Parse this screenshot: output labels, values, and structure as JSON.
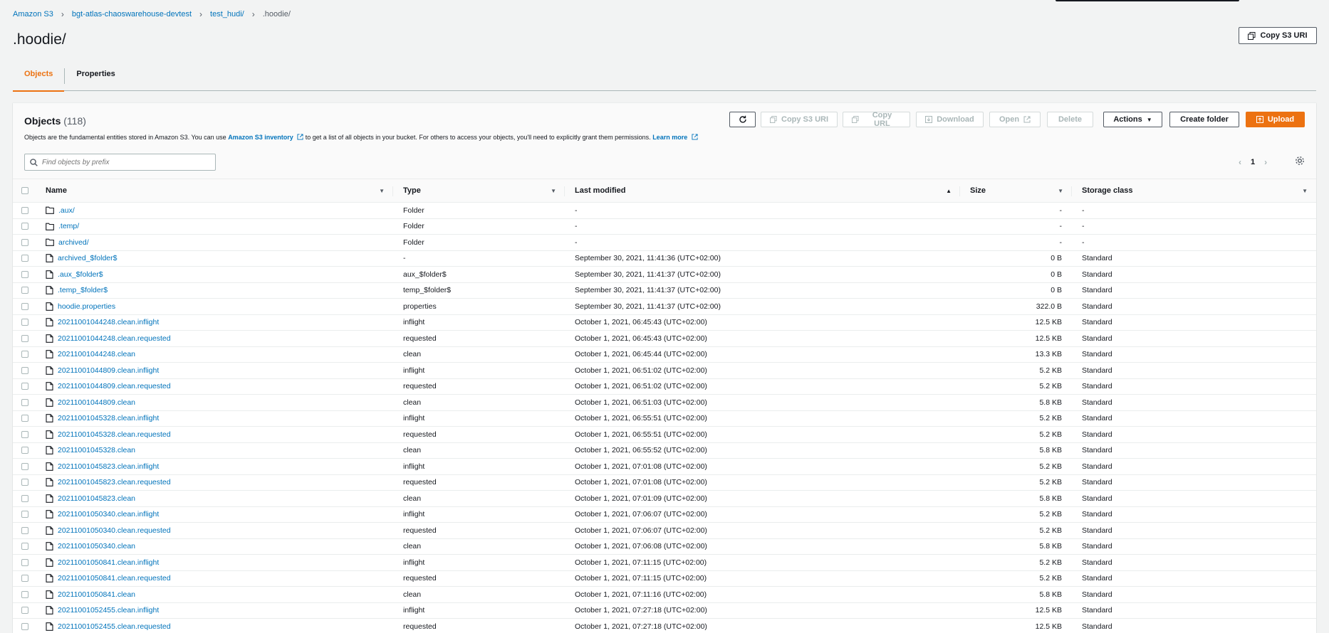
{
  "breadcrumb": [
    "Amazon S3",
    "bgt-atlas-chaoswarehouse-devtest",
    "test_hudi/",
    ".hoodie/"
  ],
  "title": ".hoodie/",
  "copy_uri_label": "Copy S3 URI",
  "tabs": [
    "Objects",
    "Properties"
  ],
  "objects": {
    "heading": "Objects",
    "count": "(118)",
    "desc_start": "Objects are the fundamental entities stored in Amazon S3. You can use ",
    "desc_link": "Amazon S3 inventory",
    "desc_mid": " to get a list of all objects in your bucket. For others to access your objects, you'll need to explicitly grant them permissions. ",
    "desc_learn": "Learn more",
    "toolbar": {
      "copy_s3_uri": "Copy S3 URI",
      "copy_url": "Copy URL",
      "download": "Download",
      "open": "Open",
      "delete": "Delete",
      "actions": "Actions",
      "create_folder": "Create folder",
      "upload": "Upload"
    },
    "search_placeholder": "Find objects by prefix",
    "page": "1",
    "columns": [
      "Name",
      "Type",
      "Last modified",
      "Size",
      "Storage class"
    ],
    "rows": [
      {
        "icon": "folder",
        "name": ".aux/",
        "type": "Folder",
        "modified": "-",
        "size": "-",
        "storage": "-"
      },
      {
        "icon": "folder",
        "name": ".temp/",
        "type": "Folder",
        "modified": "-",
        "size": "-",
        "storage": "-"
      },
      {
        "icon": "folder",
        "name": "archived/",
        "type": "Folder",
        "modified": "-",
        "size": "-",
        "storage": "-"
      },
      {
        "icon": "file",
        "name": "archived_$folder$",
        "type": "-",
        "modified": "September 30, 2021, 11:41:36 (UTC+02:00)",
        "size": "0 B",
        "storage": "Standard"
      },
      {
        "icon": "file",
        "name": ".aux_$folder$",
        "type": "aux_$folder$",
        "modified": "September 30, 2021, 11:41:37 (UTC+02:00)",
        "size": "0 B",
        "storage": "Standard"
      },
      {
        "icon": "file",
        "name": ".temp_$folder$",
        "type": "temp_$folder$",
        "modified": "September 30, 2021, 11:41:37 (UTC+02:00)",
        "size": "0 B",
        "storage": "Standard"
      },
      {
        "icon": "file",
        "name": "hoodie.properties",
        "type": "properties",
        "modified": "September 30, 2021, 11:41:37 (UTC+02:00)",
        "size": "322.0 B",
        "storage": "Standard"
      },
      {
        "icon": "file",
        "name": "20211001044248.clean.inflight",
        "type": "inflight",
        "modified": "October 1, 2021, 06:45:43 (UTC+02:00)",
        "size": "12.5 KB",
        "storage": "Standard"
      },
      {
        "icon": "file",
        "name": "20211001044248.clean.requested",
        "type": "requested",
        "modified": "October 1, 2021, 06:45:43 (UTC+02:00)",
        "size": "12.5 KB",
        "storage": "Standard"
      },
      {
        "icon": "file",
        "name": "20211001044248.clean",
        "type": "clean",
        "modified": "October 1, 2021, 06:45:44 (UTC+02:00)",
        "size": "13.3 KB",
        "storage": "Standard"
      },
      {
        "icon": "file",
        "name": "20211001044809.clean.inflight",
        "type": "inflight",
        "modified": "October 1, 2021, 06:51:02 (UTC+02:00)",
        "size": "5.2 KB",
        "storage": "Standard"
      },
      {
        "icon": "file",
        "name": "20211001044809.clean.requested",
        "type": "requested",
        "modified": "October 1, 2021, 06:51:02 (UTC+02:00)",
        "size": "5.2 KB",
        "storage": "Standard"
      },
      {
        "icon": "file",
        "name": "20211001044809.clean",
        "type": "clean",
        "modified": "October 1, 2021, 06:51:03 (UTC+02:00)",
        "size": "5.8 KB",
        "storage": "Standard"
      },
      {
        "icon": "file",
        "name": "20211001045328.clean.inflight",
        "type": "inflight",
        "modified": "October 1, 2021, 06:55:51 (UTC+02:00)",
        "size": "5.2 KB",
        "storage": "Standard"
      },
      {
        "icon": "file",
        "name": "20211001045328.clean.requested",
        "type": "requested",
        "modified": "October 1, 2021, 06:55:51 (UTC+02:00)",
        "size": "5.2 KB",
        "storage": "Standard"
      },
      {
        "icon": "file",
        "name": "20211001045328.clean",
        "type": "clean",
        "modified": "October 1, 2021, 06:55:52 (UTC+02:00)",
        "size": "5.8 KB",
        "storage": "Standard"
      },
      {
        "icon": "file",
        "name": "20211001045823.clean.inflight",
        "type": "inflight",
        "modified": "October 1, 2021, 07:01:08 (UTC+02:00)",
        "size": "5.2 KB",
        "storage": "Standard"
      },
      {
        "icon": "file",
        "name": "20211001045823.clean.requested",
        "type": "requested",
        "modified": "October 1, 2021, 07:01:08 (UTC+02:00)",
        "size": "5.2 KB",
        "storage": "Standard"
      },
      {
        "icon": "file",
        "name": "20211001045823.clean",
        "type": "clean",
        "modified": "October 1, 2021, 07:01:09 (UTC+02:00)",
        "size": "5.8 KB",
        "storage": "Standard"
      },
      {
        "icon": "file",
        "name": "20211001050340.clean.inflight",
        "type": "inflight",
        "modified": "October 1, 2021, 07:06:07 (UTC+02:00)",
        "size": "5.2 KB",
        "storage": "Standard"
      },
      {
        "icon": "file",
        "name": "20211001050340.clean.requested",
        "type": "requested",
        "modified": "October 1, 2021, 07:06:07 (UTC+02:00)",
        "size": "5.2 KB",
        "storage": "Standard"
      },
      {
        "icon": "file",
        "name": "20211001050340.clean",
        "type": "clean",
        "modified": "October 1, 2021, 07:06:08 (UTC+02:00)",
        "size": "5.8 KB",
        "storage": "Standard"
      },
      {
        "icon": "file",
        "name": "20211001050841.clean.inflight",
        "type": "inflight",
        "modified": "October 1, 2021, 07:11:15 (UTC+02:00)",
        "size": "5.2 KB",
        "storage": "Standard"
      },
      {
        "icon": "file",
        "name": "20211001050841.clean.requested",
        "type": "requested",
        "modified": "October 1, 2021, 07:11:15 (UTC+02:00)",
        "size": "5.2 KB",
        "storage": "Standard"
      },
      {
        "icon": "file",
        "name": "20211001050841.clean",
        "type": "clean",
        "modified": "October 1, 2021, 07:11:16 (UTC+02:00)",
        "size": "5.8 KB",
        "storage": "Standard"
      },
      {
        "icon": "file",
        "name": "20211001052455.clean.inflight",
        "type": "inflight",
        "modified": "October 1, 2021, 07:27:18 (UTC+02:00)",
        "size": "12.5 KB",
        "storage": "Standard"
      },
      {
        "icon": "file",
        "name": "20211001052455.clean.requested",
        "type": "requested",
        "modified": "October 1, 2021, 07:27:18 (UTC+02:00)",
        "size": "12.5 KB",
        "storage": "Standard"
      }
    ]
  },
  "colors": {
    "accent": "#ec7211",
    "link": "#0073bb",
    "text": "#16191f"
  }
}
